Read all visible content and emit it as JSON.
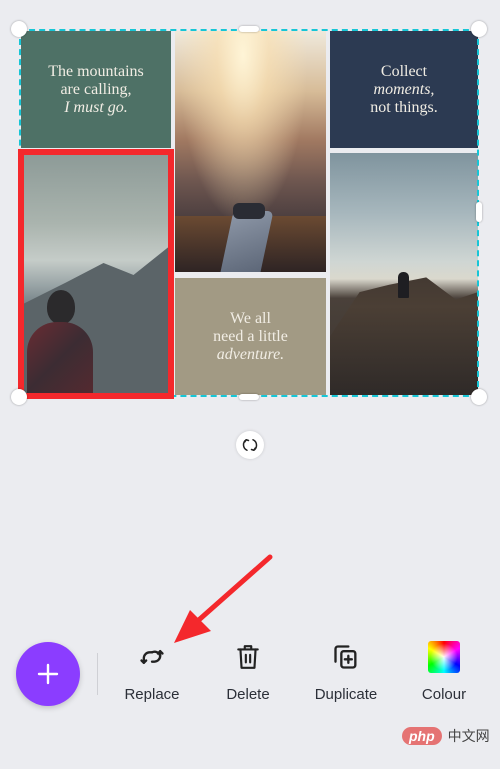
{
  "canvas": {
    "tiles": [
      {
        "name": "quote-tile-mountains",
        "type": "quote",
        "lines": [
          "The mountains",
          "are calling,"
        ],
        "italic_line": "I must go.",
        "bg": "#4e7166"
      },
      {
        "name": "photo-tile-sunrise-feet",
        "type": "photo",
        "description": "feet on rocky summit at sunrise"
      },
      {
        "name": "quote-tile-collect",
        "type": "quote",
        "lines": [
          "Collect"
        ],
        "italic_line": "moments,",
        "after_line": "not things.",
        "bg": "#2c3a52"
      },
      {
        "name": "photo-tile-man-mountains",
        "type": "photo",
        "description": "man looking at mountains",
        "selected": true
      },
      {
        "name": "quote-tile-adventure",
        "type": "quote",
        "lines": [
          "We all",
          "need a little"
        ],
        "italic_line": "adventure.",
        "bg": "#a29a84"
      },
      {
        "name": "photo-tile-couple-hill",
        "type": "photo",
        "description": "couple silhouette on hill"
      }
    ],
    "selection_color": "#16c6d6",
    "highlight_color": "#f4282c"
  },
  "toolbar": {
    "add_button_color": "#8b3dff",
    "items": [
      {
        "label": "Replace",
        "icon": "replace-icon"
      },
      {
        "label": "Delete",
        "icon": "trash-icon"
      },
      {
        "label": "Duplicate",
        "icon": "duplicate-icon"
      },
      {
        "label": "Colour",
        "icon": "colour-swatch-icon"
      }
    ]
  },
  "watermark": {
    "logo": "php",
    "text": "中文网"
  }
}
